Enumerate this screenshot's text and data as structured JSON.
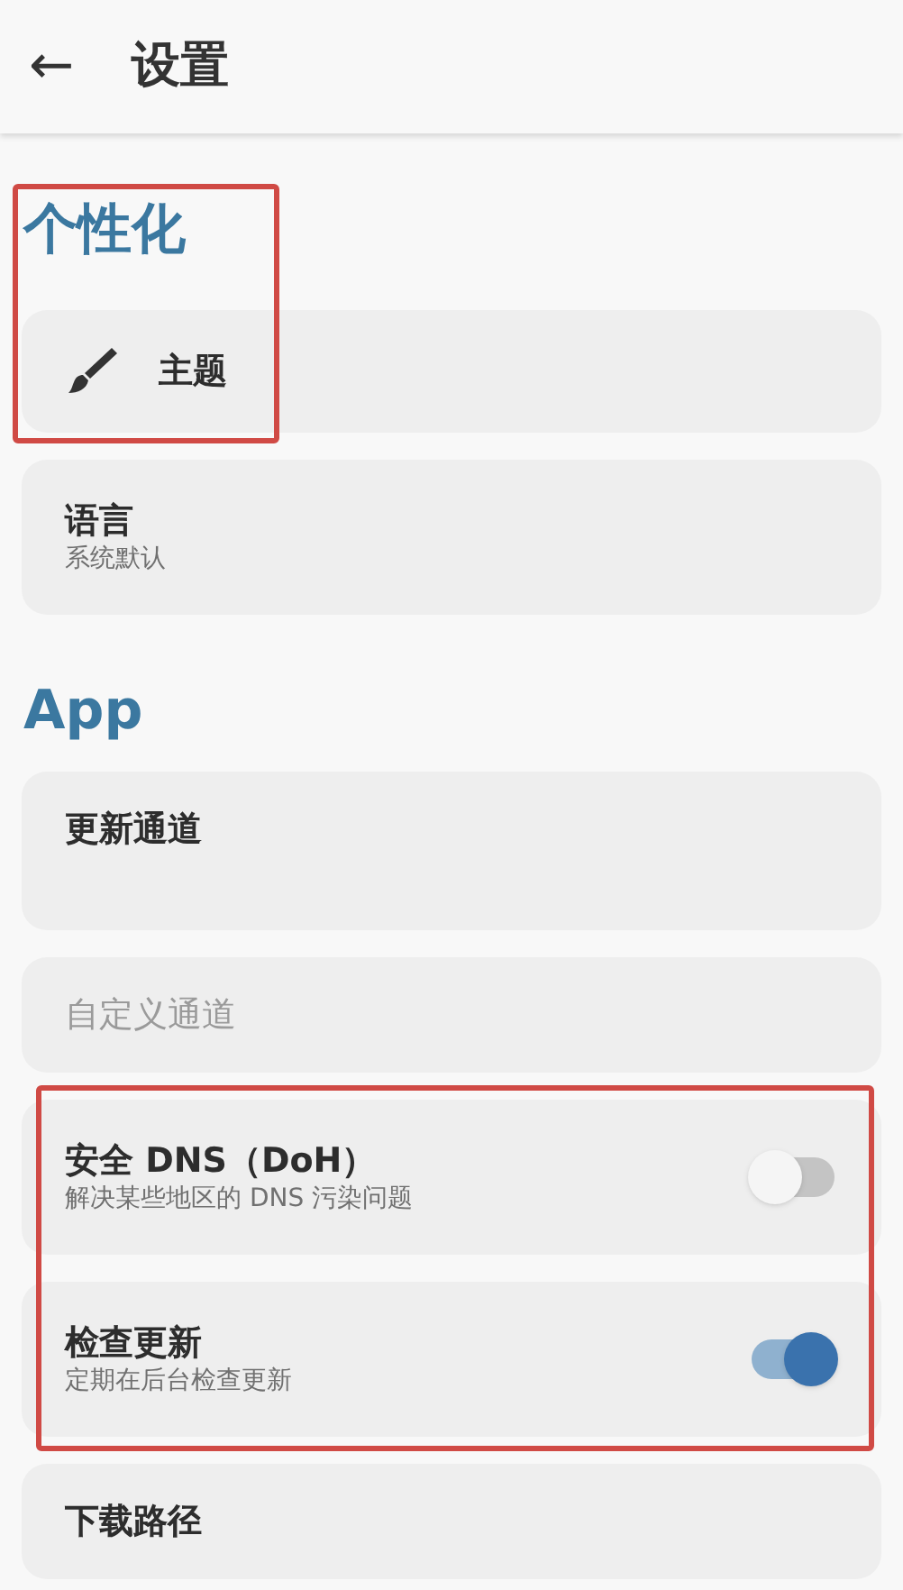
{
  "header": {
    "back_icon": "←",
    "title": "设置"
  },
  "sections": [
    {
      "title": "个性化",
      "highlighted": true,
      "items": [
        {
          "kind": "icon_link",
          "title": "主题",
          "disabled": false,
          "highlighted": true
        },
        {
          "kind": "link",
          "title": "语言",
          "subtitle": "系统默认",
          "disabled": false,
          "highlighted": false
        }
      ]
    },
    {
      "title": "App",
      "highlighted": false,
      "items": [
        {
          "kind": "link",
          "title": "更新通道",
          "disabled": false,
          "highlighted": false
        },
        {
          "kind": "link",
          "title": "自定义通道",
          "disabled": true,
          "highlighted": false
        },
        {
          "kind": "switch",
          "title": "安全 DNS（DoH）",
          "subtitle": "解决某些地区的 DNS 污染问题",
          "on": false,
          "disabled": false,
          "highlighted": true
        },
        {
          "kind": "switch",
          "title": "检查更新",
          "subtitle": "定期在后台检查更新",
          "on": true,
          "disabled": false,
          "highlighted": true
        },
        {
          "kind": "link",
          "title": "下载路径",
          "disabled": false,
          "highlighted": false
        }
      ]
    }
  ]
}
